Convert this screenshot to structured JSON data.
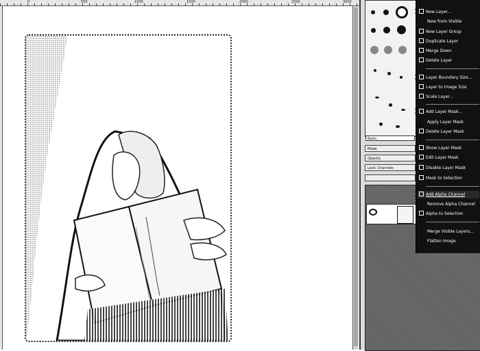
{
  "ruler": {
    "marks": [
      "0",
      "500",
      "1000",
      "1500",
      "2000",
      "2500",
      "3000"
    ]
  },
  "context_menu": {
    "items": [
      {
        "label": "New Layer...",
        "icon": "new-layer-icon"
      },
      {
        "label": "New from Visible",
        "icon": ""
      },
      {
        "label": "New Layer Group",
        "icon": "layer-group-icon"
      },
      {
        "label": "Duplicate Layer",
        "icon": "duplicate-icon"
      },
      {
        "label": "Merge Down",
        "icon": "merge-down-icon"
      },
      {
        "label": "Delete Layer",
        "icon": "delete-icon"
      },
      {
        "label": "Layer Boundary Size...",
        "icon": "boundary-icon"
      },
      {
        "label": "Layer to Image Size",
        "icon": "to-image-size-icon"
      },
      {
        "label": "Scale Layer...",
        "icon": "scale-icon"
      },
      {
        "label": "Add Layer Mask...",
        "icon": "add-mask-icon"
      },
      {
        "label": "Apply Layer Mask",
        "icon": ""
      },
      {
        "label": "Delete Layer Mask",
        "icon": "delete-mask-icon"
      },
      {
        "label": "Show Layer Mask",
        "icon": "checkbox-icon"
      },
      {
        "label": "Edit Layer Mask",
        "icon": "checkbox-icon"
      },
      {
        "label": "Disable Layer Mask",
        "icon": "checkbox-icon"
      },
      {
        "label": "Mask to Selection",
        "icon": "mask-selection-icon"
      },
      {
        "label": "Add Alpha Channel",
        "icon": "alpha-icon"
      },
      {
        "label": "Remove Alpha Channel",
        "icon": ""
      },
      {
        "label": "Alpha to Selection",
        "icon": "alpha-selection-icon"
      },
      {
        "label": "Merge Visible Layers...",
        "icon": ""
      },
      {
        "label": "Flatten Image",
        "icon": ""
      }
    ]
  },
  "brushes": {
    "filter_label": "Basic,"
  },
  "dock": {
    "mode_label": "Mode",
    "opacity_label": "Opacity",
    "lock_label": "Lock:",
    "channels_label": "Channels"
  },
  "colors": {
    "menu_bg": "#111111",
    "menu_text": "#ffffff",
    "dock_bg": "#dcdcdc"
  }
}
